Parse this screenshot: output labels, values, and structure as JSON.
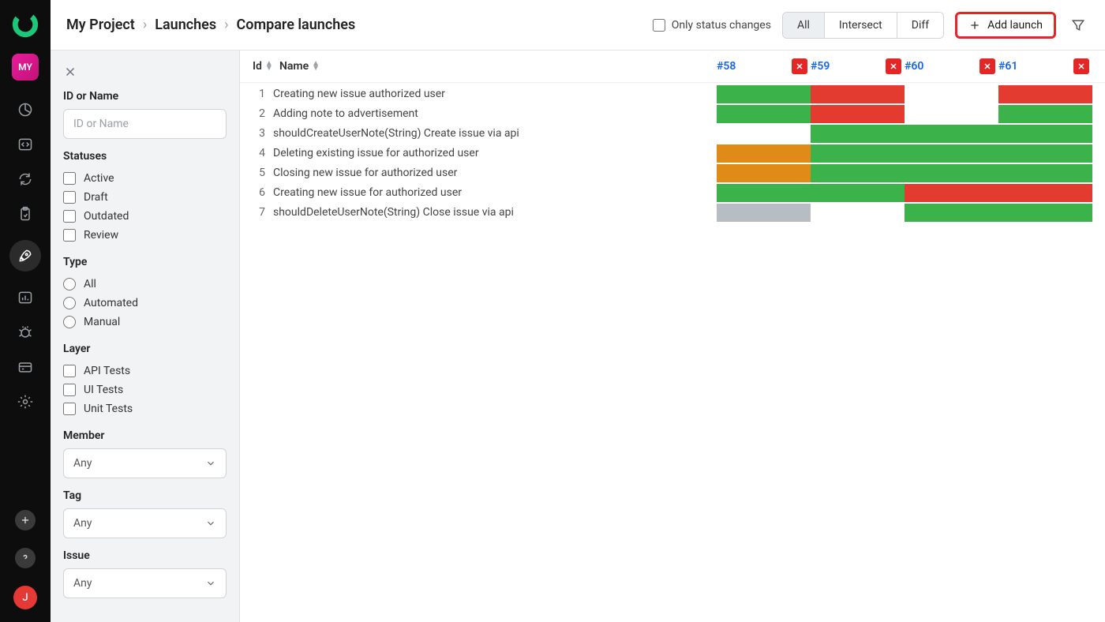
{
  "rail": {
    "project_badge": "MY",
    "user_initial": "J"
  },
  "breadcrumb": {
    "project": "My Project",
    "section": "Launches",
    "current": "Compare launches"
  },
  "toolbar": {
    "only_status": "Only status changes",
    "seg_all": "All",
    "seg_intersect": "Intersect",
    "seg_diff": "Diff",
    "add_launch": "Add launch"
  },
  "filters": {
    "id_name_label": "ID or Name",
    "id_name_placeholder": "ID or Name",
    "statuses_label": "Statuses",
    "statuses": [
      "Active",
      "Draft",
      "Outdated",
      "Review"
    ],
    "type_label": "Type",
    "types": [
      "All",
      "Automated",
      "Manual"
    ],
    "layer_label": "Layer",
    "layers": [
      "API Tests",
      "UI Tests",
      "Unit Tests"
    ],
    "member_label": "Member",
    "member_value": "Any",
    "tag_label": "Tag",
    "tag_value": "Any",
    "issue_label": "Issue",
    "issue_value": "Any"
  },
  "table": {
    "header_id": "Id",
    "header_name": "Name",
    "launches": [
      "#58",
      "#59",
      "#60",
      "#61"
    ],
    "rows": [
      {
        "id": "1",
        "name": "Creating new issue authorized user",
        "cells": [
          "passed",
          "failed",
          "none",
          "failed"
        ]
      },
      {
        "id": "2",
        "name": "Adding note to advertisement",
        "cells": [
          "passed",
          "failed",
          "none",
          "passed"
        ]
      },
      {
        "id": "3",
        "name": "shouldCreateUserNote(String) Create issue via api",
        "cells": [
          "none",
          "passed",
          "passed",
          "passed"
        ]
      },
      {
        "id": "4",
        "name": "Deleting existing issue for authorized user",
        "cells": [
          "broken",
          "passed",
          "passed",
          "passed"
        ]
      },
      {
        "id": "5",
        "name": "Closing new issue for authorized user",
        "cells": [
          "broken",
          "passed",
          "passed",
          "passed"
        ]
      },
      {
        "id": "6",
        "name": "Creating new issue for authorized user",
        "cells": [
          "passed",
          "passed",
          "failed",
          "failed"
        ]
      },
      {
        "id": "7",
        "name": "shouldDeleteUserNote(String) Close issue via api",
        "cells": [
          "skipped",
          "none",
          "passed",
          "passed"
        ]
      }
    ]
  }
}
